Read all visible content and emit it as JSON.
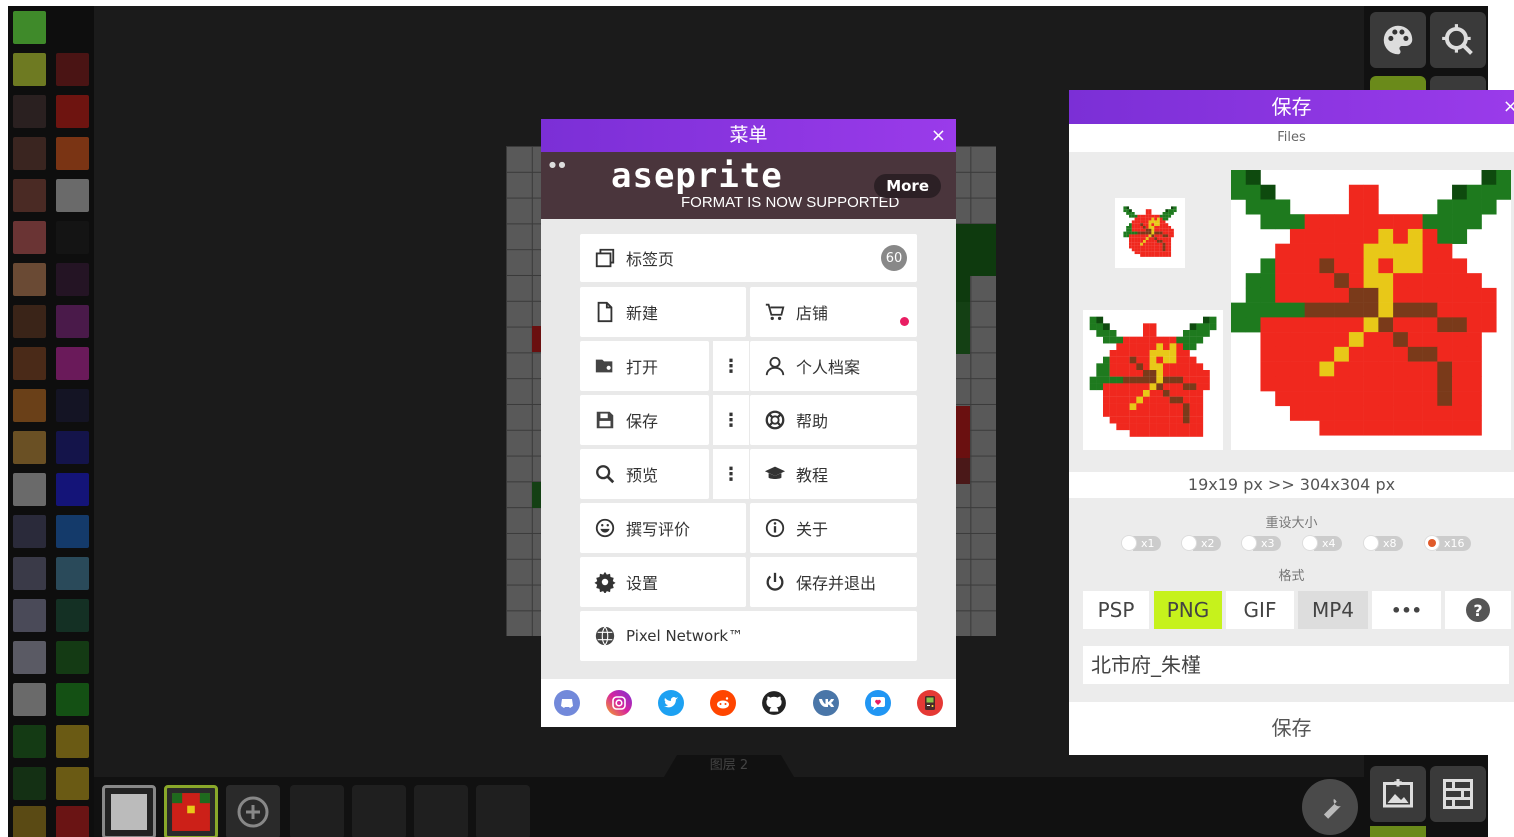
{
  "menu": {
    "title": "菜单",
    "close": "×",
    "banner_logo": "aseprite",
    "banner_sub": "FORMAT IS NOW SUPPORTED",
    "banner_more": "More",
    "tabs_label": "标签页",
    "tabs_count": "60",
    "new_label": "新建",
    "store_label": "店铺",
    "open_label": "打开",
    "profile_label": "个人档案",
    "save_label": "保存",
    "help_label": "帮助",
    "preview_label": "预览",
    "tutorial_label": "教程",
    "review_label": "撰写评价",
    "about_label": "关于",
    "settings_label": "设置",
    "save_exit_label": "保存并退出",
    "network_label": "Pixel Network™",
    "kebab": "⋮"
  },
  "save_dialog": {
    "title": "保存",
    "close": "×",
    "files_label": "Files",
    "dimensions": "19x19 px >> 304x304 px",
    "resize_label": "重设大小",
    "scales": [
      "x1",
      "x2",
      "x3",
      "x4",
      "x8",
      "x16"
    ],
    "selected_scale": "x16",
    "format_label": "格式",
    "formats": [
      "PSP",
      "PNG",
      "GIF",
      "MP4",
      "•••",
      "?"
    ],
    "selected_format": "PNG",
    "filename": "北市府_朱槿",
    "save_button": "保存"
  },
  "layer_tab": "图层 2",
  "colors": {
    "accent_purple": "#8a35e0",
    "png_highlight": "#c6f21c",
    "radio_selected": "#e05a2a",
    "flower_red": "#f0281e",
    "leaf_green": "#1e7a1e"
  }
}
